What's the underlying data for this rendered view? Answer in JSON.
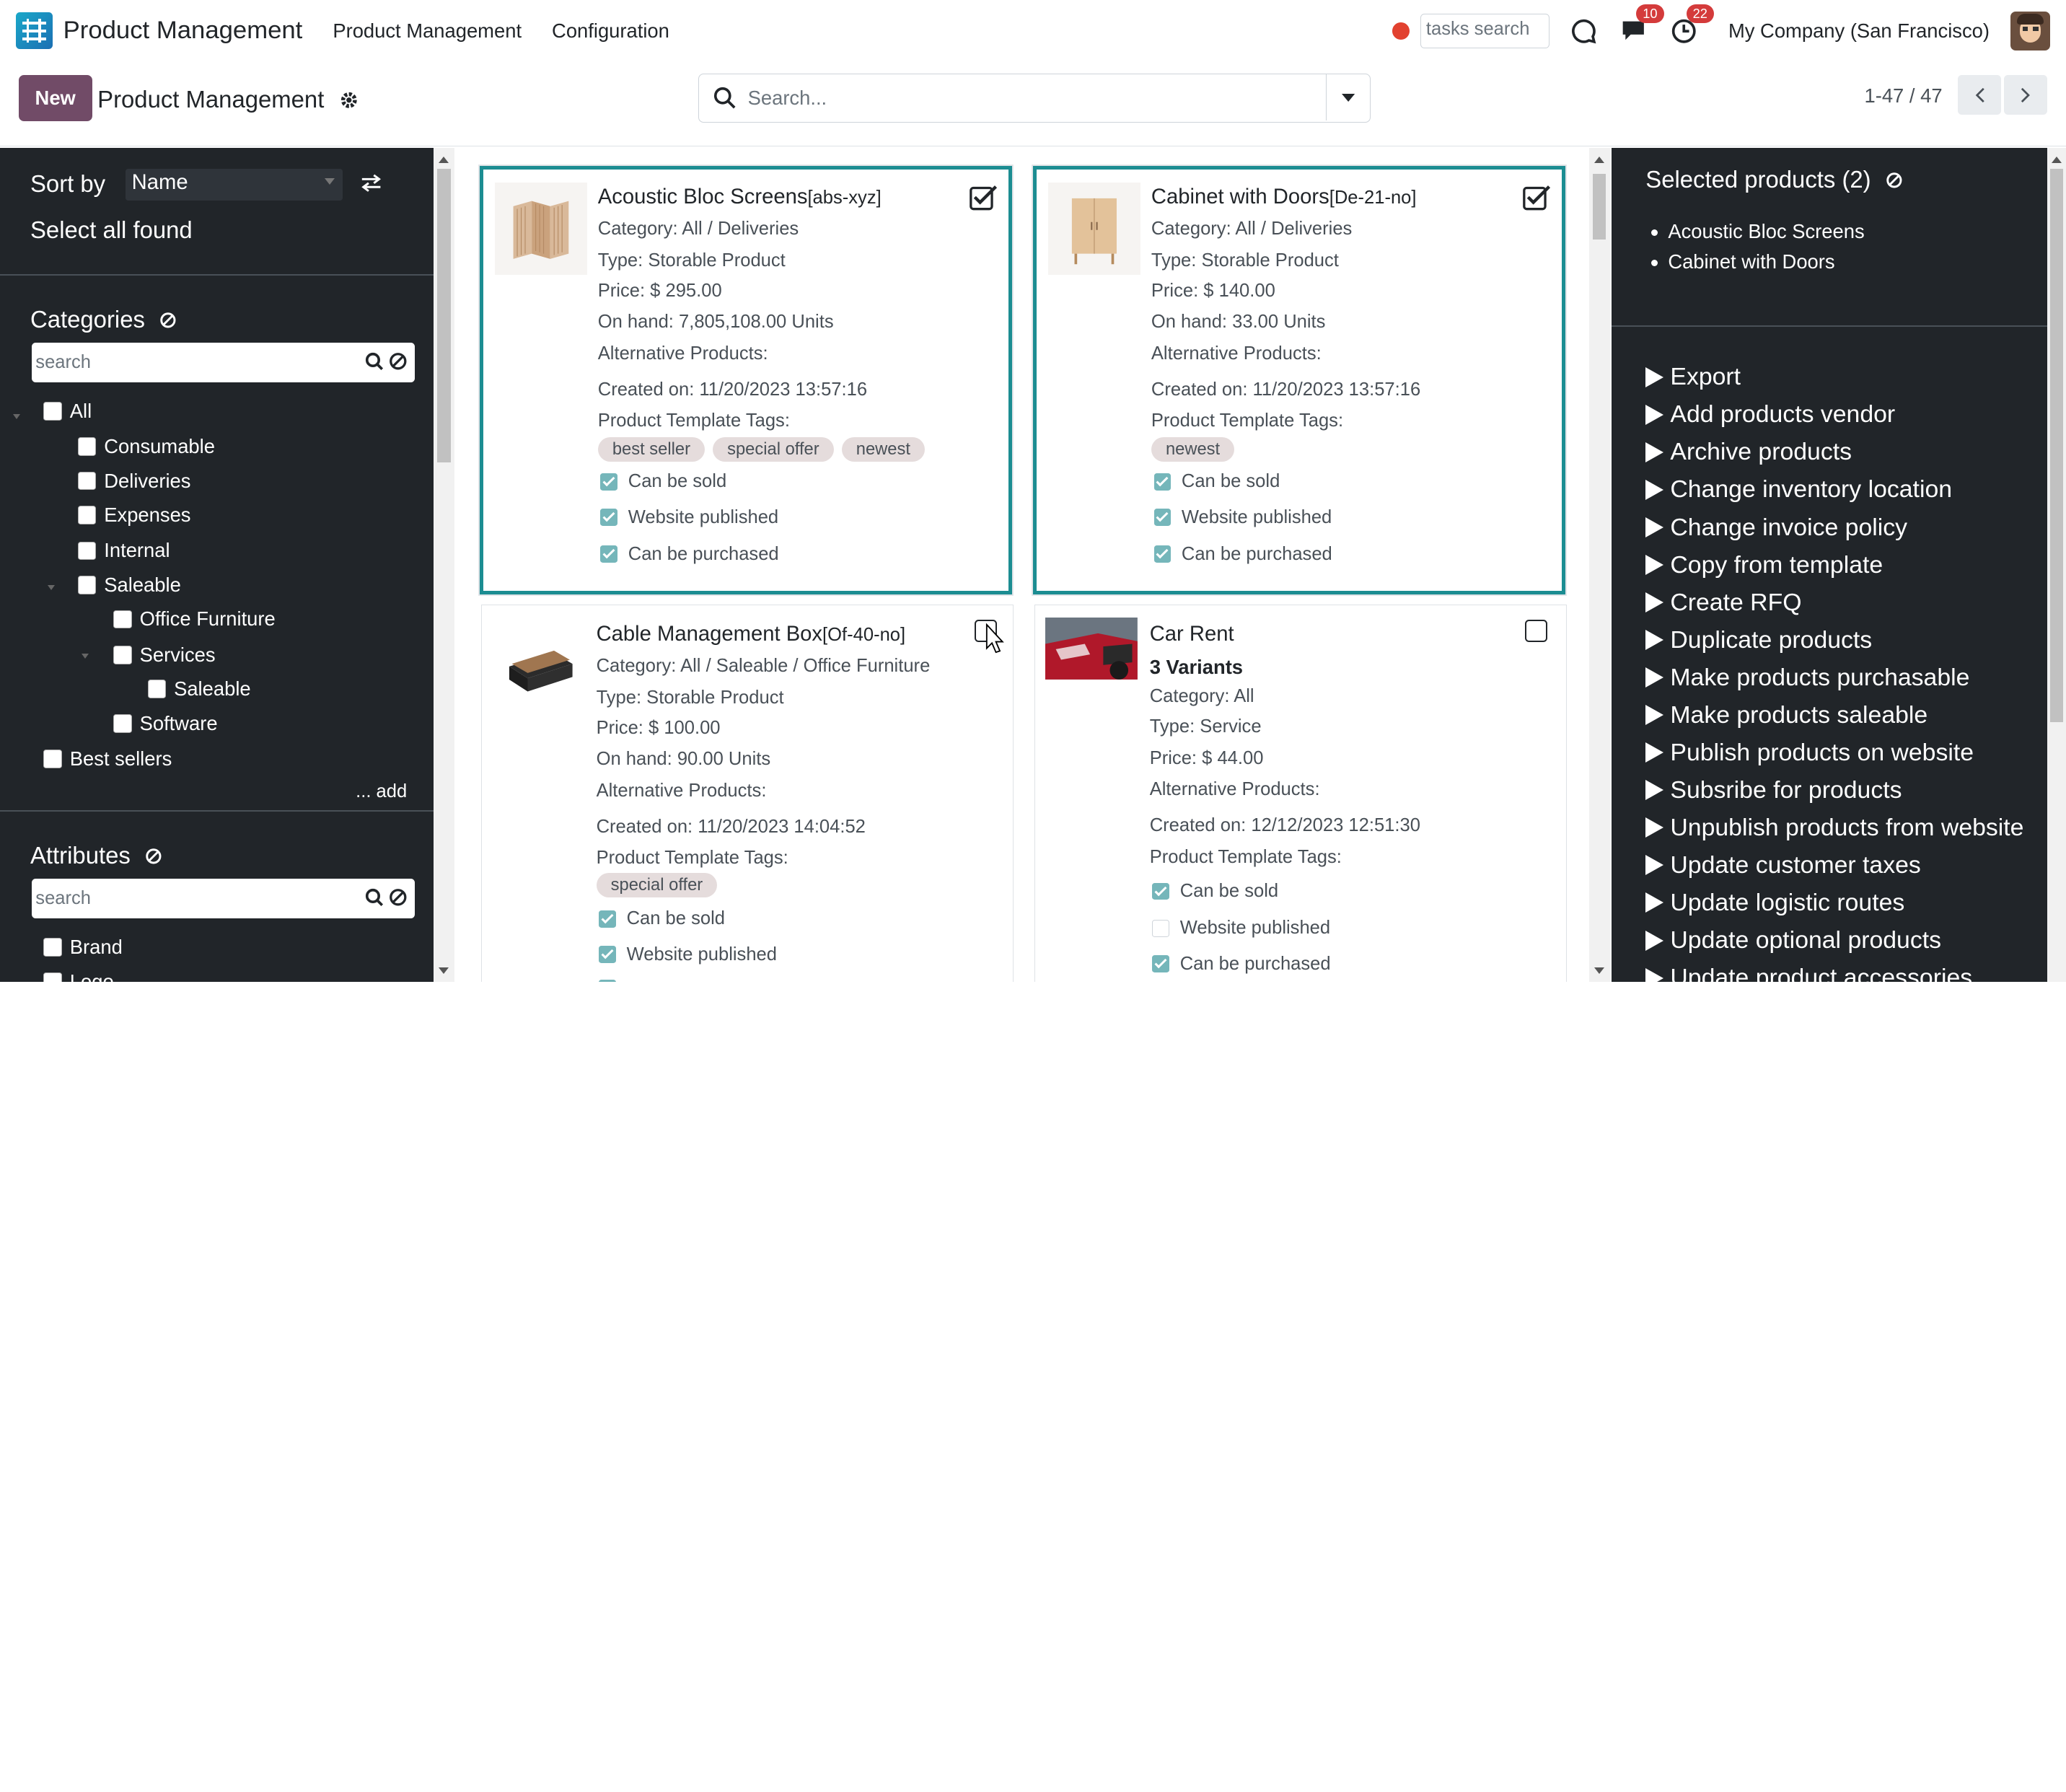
{
  "navbar": {
    "app_name": "Product Management",
    "menus": [
      "Product Management",
      "Configuration"
    ],
    "tasks_search_placeholder": "tasks search",
    "messages_count": "10",
    "activities_count": "22",
    "company": "My Company (San Francisco)"
  },
  "control_panel": {
    "new_label": "New",
    "title": "Product Management",
    "search_placeholder": "Search...",
    "pager": "1-47 / 47"
  },
  "left_panel": {
    "sort_by_label": "Sort by",
    "sort_value": "Name",
    "select_all_label": "Select all found",
    "categories_title": "Categories",
    "categories_search_placeholder": "search",
    "categories": [
      {
        "label": "All"
      },
      {
        "label": "Consumable"
      },
      {
        "label": "Deliveries"
      },
      {
        "label": "Expenses"
      },
      {
        "label": "Internal"
      },
      {
        "label": "Saleable"
      },
      {
        "label": "Office Furniture"
      },
      {
        "label": "Services"
      },
      {
        "label": "Saleable"
      },
      {
        "label": "Software"
      },
      {
        "label": "Best sellers"
      }
    ],
    "add_label": "... add",
    "attributes_title": "Attributes",
    "attributes_search_placeholder": "search",
    "attributes": [
      {
        "label": "Brand"
      },
      {
        "label": "Logo"
      }
    ]
  },
  "products": [
    {
      "name": "Acoustic Bloc Screens",
      "code": "[abs-xyz]",
      "variants": "",
      "category": "Category: All / Deliveries",
      "type": "Type: Storable Product",
      "price": "Price: $ 295.00",
      "on_hand": "On hand: 7,805,108.00 Units",
      "alternative": "Alternative Products:",
      "created": "Created on: 11/20/2023 13:57:16",
      "tags_label": "Product Template Tags:",
      "tags": [
        "best seller",
        "special offer",
        "newest"
      ],
      "checks": [
        {
          "label": "Can be sold",
          "on": true
        },
        {
          "label": "Website published",
          "on": true
        },
        {
          "label": "Can be purchased",
          "on": true
        }
      ],
      "selected": true
    },
    {
      "name": "Cabinet with Doors",
      "code": "[De-21-no]",
      "variants": "",
      "category": "Category: All / Deliveries",
      "type": "Type: Storable Product",
      "price": "Price: $ 140.00",
      "on_hand": "On hand: 33.00 Units",
      "alternative": "Alternative Products:",
      "created": "Created on: 11/20/2023 13:57:16",
      "tags_label": "Product Template Tags:",
      "tags": [
        "newest"
      ],
      "checks": [
        {
          "label": "Can be sold",
          "on": true
        },
        {
          "label": "Website published",
          "on": true
        },
        {
          "label": "Can be purchased",
          "on": true
        }
      ],
      "selected": true
    },
    {
      "name": "Cable Management Box",
      "code": "[Of-40-no]",
      "variants": "",
      "category": "Category: All / Saleable / Office Furniture",
      "type": "Type: Storable Product",
      "price": "Price: $ 100.00",
      "on_hand": "On hand: 90.00 Units",
      "alternative": "Alternative Products:",
      "created": "Created on: 11/20/2023 14:04:52",
      "tags_label": "Product Template Tags:",
      "tags": [
        "special offer"
      ],
      "checks": [
        {
          "label": "Can be sold",
          "on": true
        },
        {
          "label": "Website published",
          "on": true
        }
      ],
      "selected": false
    },
    {
      "name": "Car Rent",
      "code": "",
      "variants": "3 Variants",
      "category": "Category: All",
      "type": "Type: Service",
      "price": "Price: $ 44.00",
      "on_hand": "",
      "alternative": "Alternative Products:",
      "created": "Created on: 12/12/2023 12:51:30",
      "tags_label": "Product Template Tags:",
      "tags": [],
      "checks": [
        {
          "label": "Can be sold",
          "on": true
        },
        {
          "label": "Website published",
          "on": false
        },
        {
          "label": "Can be purchased",
          "on": true
        }
      ],
      "selected": false
    }
  ],
  "right_panel": {
    "selected_title": "Selected products (2)",
    "selected_items": [
      "Acoustic Bloc Screens",
      "Cabinet with Doors"
    ],
    "actions": [
      "Export",
      "Add products vendor",
      "Archive products",
      "Change inventory location",
      "Change invoice policy",
      "Copy from template",
      "Create RFQ",
      "Duplicate products",
      "Make products purchasable",
      "Make products saleable",
      "Publish products on website",
      "Subsribe for products",
      "Unpublish products from website",
      "Update customer taxes",
      "Update logistic routes",
      "Update optional products",
      "Update product accessories"
    ]
  },
  "colors": {
    "brand": "#714b67",
    "selected_border": "#1c8d92",
    "panel_bg": "#212529"
  }
}
